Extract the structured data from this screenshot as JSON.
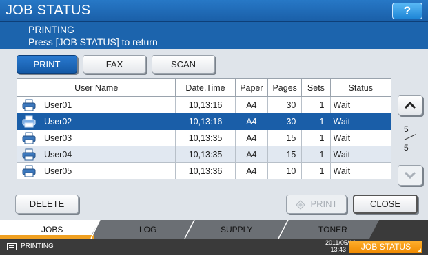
{
  "title": "JOB STATUS",
  "help_label": "?",
  "message": {
    "line1": "PRINTING",
    "line2": "Press [JOB STATUS] to return"
  },
  "category_tabs": [
    {
      "label": "PRINT",
      "active": true
    },
    {
      "label": "FAX",
      "active": false
    },
    {
      "label": "SCAN",
      "active": false
    }
  ],
  "table": {
    "columns": [
      "User Name",
      "Date,Time",
      "Paper",
      "Pages",
      "Sets",
      "Status"
    ],
    "rows": [
      {
        "user": "User01",
        "datetime": "10,13:16",
        "paper": "A4",
        "pages": "30",
        "sets": "1",
        "status": "Wait",
        "selected": false
      },
      {
        "user": "User02",
        "datetime": "10,13:16",
        "paper": "A4",
        "pages": "30",
        "sets": "1",
        "status": "Wait",
        "selected": true
      },
      {
        "user": "User03",
        "datetime": "10,13:35",
        "paper": "A4",
        "pages": "15",
        "sets": "1",
        "status": "Wait",
        "selected": false
      },
      {
        "user": "User04",
        "datetime": "10,13:35",
        "paper": "A4",
        "pages": "15",
        "sets": "1",
        "status": "Wait",
        "selected": false
      },
      {
        "user": "User05",
        "datetime": "10,13:36",
        "paper": "A4",
        "pages": "10",
        "sets": "1",
        "status": "Wait",
        "selected": false
      }
    ]
  },
  "pager": {
    "current": "5",
    "total": "5"
  },
  "actions": {
    "delete_label": "DELETE",
    "print_label": "PRINT",
    "close_label": "CLOSE"
  },
  "bottom_tabs": [
    "JOBS",
    "LOG",
    "SUPPLY",
    "TONER"
  ],
  "status_bar": {
    "text": "PRINTING",
    "date": "2011/05/10",
    "time": "13:43",
    "job_status_label": "JOB STATUS"
  },
  "colors": {
    "title_blue": "#1a5fa8",
    "selected_row": "#1a5ea8",
    "accent_orange": "#f08a00",
    "tab_underline": "#f0a020"
  }
}
